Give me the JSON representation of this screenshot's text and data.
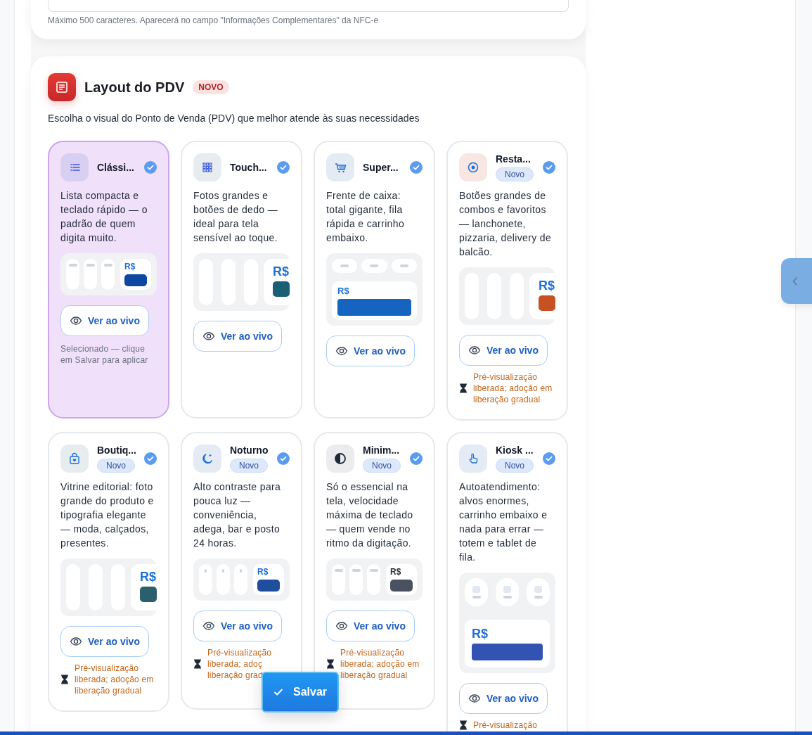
{
  "notes_field": {
    "hint": "Máximo 500 caracteres. Aparecerá no campo \"Informações Complementares\" da NFC-e"
  },
  "layout_section": {
    "title": "Layout do PDV",
    "badge": "NOVO",
    "subtitle": "Escolha o visual do Ponto de Venda (PDV) que melhor atende às suas necessidades",
    "options": [
      {
        "title": "Clássi...",
        "selected": true,
        "description": "Lista compacta e teclado rápido — o padrão de quem digita muito.",
        "preview": {
          "kind": "compact",
          "currency": "R$",
          "color": "#0d47a1"
        },
        "button": "Ver ao vivo",
        "note": {
          "kind": "selected",
          "text": "Selecionado — clique em Salvar para aplicar"
        }
      },
      {
        "title": "Touch...",
        "selected": false,
        "description": "Fotos grandes e botões de dedo — ideal para tela sensível ao toque.",
        "preview": {
          "kind": "wide",
          "currency": "R$",
          "color": "#1a5f73"
        },
        "button": "Ver ao vivo"
      },
      {
        "title": "Super...",
        "selected": false,
        "description": "Frente de caixa: total gigante, fila rápida e carrinho embaixo.",
        "preview": {
          "kind": "stacked",
          "currency": "R$",
          "color": "#1565c0"
        },
        "button": "Ver ao vivo"
      },
      {
        "title": "Resta...",
        "badge": "Novo",
        "selected": false,
        "description": "Botões grandes de combos e favoritos — lanchonete, pizzaria, delivery de balcão.",
        "preview": {
          "kind": "wide",
          "currency": "R$",
          "color": "#c65224"
        },
        "button": "Ver ao vivo",
        "note": {
          "kind": "rollout",
          "lines": [
            "Pré-visualização",
            "liberada; adoção em",
            "liberação gradual"
          ]
        }
      },
      {
        "title": "Boutiq...",
        "badge": "Novo",
        "selected": false,
        "description": "Vitrine editorial: foto grande do produto e tipografia elegante — moda, calçados, presentes.",
        "preview": {
          "kind": "wide",
          "currency": "R$",
          "color": "#2b5f6e"
        },
        "button": "Ver ao vivo",
        "note": {
          "kind": "rollout",
          "lines": [
            "Pré-visualização",
            "liberada; adoção em",
            "liberação gradual"
          ]
        }
      },
      {
        "title": "Noturno",
        "badge": "Novo",
        "selected": false,
        "description": "Alto contraste para pouca luz — conveniência, adega, bar e posto 24 horas.",
        "preview": {
          "kind": "compact",
          "currency": "R$",
          "color": "#1f4e9c"
        },
        "button": "Ver ao vivo",
        "note": {
          "kind": "rollout",
          "lines": [
            "Pré-visualização",
            "liberada; adoç",
            "liberação grad"
          ]
        }
      },
      {
        "title": "Minim...",
        "badge": "Novo",
        "selected": false,
        "description": "Só o essencial na tela, velocidade máxima de teclado — quem vende no ritmo da digitação.",
        "preview": {
          "kind": "compact",
          "currency": "R$",
          "color": "#4a5261"
        },
        "button": "Ver ao vivo",
        "note": {
          "kind": "rollout",
          "lines": [
            "Pré-visualização",
            "liberada; adoção em",
            "liberação gradual"
          ]
        }
      },
      {
        "title": "Kiosk ...",
        "badge": "Novo",
        "selected": false,
        "description": "Autoatendimento: alvos enormes, carrinho embaixo e nada para errar — totem e tablet de fila.",
        "preview": {
          "kind": "kiosk",
          "currency": "R$",
          "color": "#3353b3"
        },
        "button": "Ver ao vivo",
        "note": {
          "kind": "rollout",
          "lines": [
            "Pré-visualização"
          ]
        }
      }
    ]
  },
  "save_button": "Salvar"
}
